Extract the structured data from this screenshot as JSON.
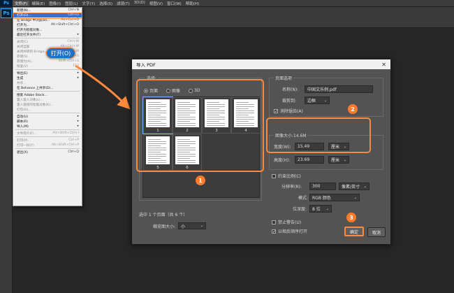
{
  "menubar": {
    "items": [
      "文件(F)",
      "编辑(E)",
      "图像(I)",
      "图层(L)",
      "文字(Y)",
      "选择(S)",
      "滤镜(T)",
      "3D(D)",
      "视图(V)",
      "窗口(W)",
      "帮助(H)"
    ]
  },
  "app_badge": "Ps",
  "file_menu": {
    "items": [
      {
        "label": "新建(N)...",
        "shortcut": "Ctrl+N",
        "state": "normal"
      },
      {
        "label": "打开(O)...",
        "shortcut": "Ctrl+O",
        "state": "highlight"
      },
      {
        "label": "在 Bridge 中浏览(B)...",
        "shortcut": "Alt+Ctrl+O",
        "state": "normal"
      },
      {
        "label": "打开为...",
        "shortcut": "Alt+Shift+Ctrl+O",
        "state": "normal"
      },
      {
        "label": "打开为智能对象...",
        "shortcut": "",
        "state": "normal"
      },
      {
        "label": "最近打开文件(T)",
        "shortcut": "▸",
        "state": "normal"
      },
      {
        "sep": true
      },
      {
        "label": "关闭(C)",
        "shortcut": "Ctrl+W",
        "state": "disabled"
      },
      {
        "label": "关闭全部",
        "shortcut": "Alt+Ctrl+W",
        "state": "disabled"
      },
      {
        "label": "关闭并转到 Bridge...",
        "shortcut": "Shift+Ctrl+W",
        "state": "disabled"
      },
      {
        "label": "存储(S)",
        "shortcut": "Ctrl+S",
        "state": "disabled"
      },
      {
        "label": "存储为(A)...",
        "shortcut": "Shift+Ctrl+S",
        "state": "disabled"
      },
      {
        "label": "恢复(V)",
        "shortcut": "F12",
        "state": "disabled"
      },
      {
        "sep": true
      },
      {
        "label": "导出(E)",
        "shortcut": "▸",
        "state": "normal"
      },
      {
        "label": "生成",
        "shortcut": "▸",
        "state": "normal"
      },
      {
        "label": "共享...",
        "shortcut": "",
        "state": "disabled"
      },
      {
        "label": "在 Behance 上共享(D)...",
        "shortcut": "",
        "state": "normal"
      },
      {
        "sep": true
      },
      {
        "label": "搜索 Adobe Stock...",
        "shortcut": "",
        "state": "normal"
      },
      {
        "label": "置入嵌入对象(L)...",
        "shortcut": "",
        "state": "disabled"
      },
      {
        "label": "置入链接的智能对象(K)...",
        "shortcut": "",
        "state": "disabled"
      },
      {
        "label": "打包(G)...",
        "shortcut": "",
        "state": "disabled"
      },
      {
        "sep": true
      },
      {
        "label": "自动(U)",
        "shortcut": "▸",
        "state": "normal"
      },
      {
        "label": "脚本(R)",
        "shortcut": "▸",
        "state": "normal"
      },
      {
        "label": "导入(M)",
        "shortcut": "▸",
        "state": "normal"
      },
      {
        "sep": true
      },
      {
        "label": "文件简介(F)...",
        "shortcut": "Alt+Shift+Ctrl+I",
        "state": "disabled"
      },
      {
        "sep": true
      },
      {
        "label": "打印(P)...",
        "shortcut": "Ctrl+P",
        "state": "disabled"
      },
      {
        "label": "打印一份(Y)",
        "shortcut": "Alt+Shift+Ctrl+P",
        "state": "disabled"
      },
      {
        "sep": true
      },
      {
        "label": "退出(X)",
        "shortcut": "Ctrl+Q",
        "state": "normal"
      }
    ]
  },
  "callout": {
    "open_label": "打开(O)"
  },
  "dialog": {
    "title": "导入 PDF",
    "select_label": "选择:",
    "radios": [
      "页面",
      "图像",
      "3D"
    ],
    "thumbnails": [
      {
        "num": "1"
      },
      {
        "num": "2"
      },
      {
        "num": "3"
      },
      {
        "num": "4"
      },
      {
        "num": "5"
      },
      {
        "num": "6"
      }
    ],
    "status": "选中 1 个页面（共 6 个）",
    "thumb_size_label": "缩览图大小:",
    "thumb_size_value": "小",
    "page_options_label": "页面选项",
    "name_label": "名称(N):",
    "name_value": "中国文乐例.pdf",
    "crop_label": "裁剪到:",
    "crop_value": "边框",
    "antialias_label": "消除锯齿(A)",
    "image_size_label": "图像大小:14.6M",
    "width_label": "宽度(W):",
    "width_value": "15.49",
    "width_unit": "厘米",
    "height_label": "高度(H):",
    "height_value": "23.69",
    "height_unit": "厘米",
    "constrain_label": "约束比例(C)",
    "resolution_label": "分辨率(R):",
    "resolution_value": "300",
    "resolution_unit": "像素/英寸",
    "mode_label": "模式:",
    "mode_value": "RGB 颜色",
    "bit_label": "位深度:",
    "bit_value": "8 位",
    "suppress_label": "禁止警告(U)",
    "reverse_label": "以相反顺序打开",
    "ok_label": "确定",
    "cancel_label": "取消"
  },
  "annotations": {
    "badge1": "1",
    "badge2": "2",
    "badge3": "3"
  },
  "colors": {
    "accent": "#ff8a3d",
    "highlight": "#3a6fd0",
    "ps_blue": "#31a8ff"
  }
}
